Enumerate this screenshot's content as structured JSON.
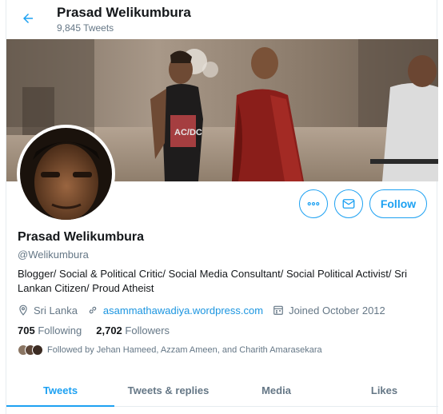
{
  "header": {
    "name": "Prasad Welikumbura",
    "tweet_count": "9,845 Tweets"
  },
  "profile": {
    "name": "Prasad Welikumbura",
    "handle": "@Welikumbura",
    "bio": "Blogger/ Social & Political Critic/ Social Media Consultant/ Social Political Activist/ Sri Lankan Citizen/ Proud Atheist",
    "location": "Sri Lanka",
    "website": "asammathawadiya.wordpress.com",
    "joined": "Joined October 2012"
  },
  "actions": {
    "follow_label": "Follow"
  },
  "stats": {
    "following_count": "705",
    "following_label": "Following",
    "followers_count": "2,702",
    "followers_label": "Followers"
  },
  "followed_by": "Followed by Jehan Hameed, Azzam Ameen, and Charith Amarasekara",
  "tabs": [
    {
      "label": "Tweets",
      "active": true
    },
    {
      "label": "Tweets & replies",
      "active": false
    },
    {
      "label": "Media",
      "active": false
    },
    {
      "label": "Likes",
      "active": false
    }
  ],
  "colors": {
    "accent": "#1da1f2",
    "link": "#1b95e0",
    "secondary_text": "#657786"
  }
}
